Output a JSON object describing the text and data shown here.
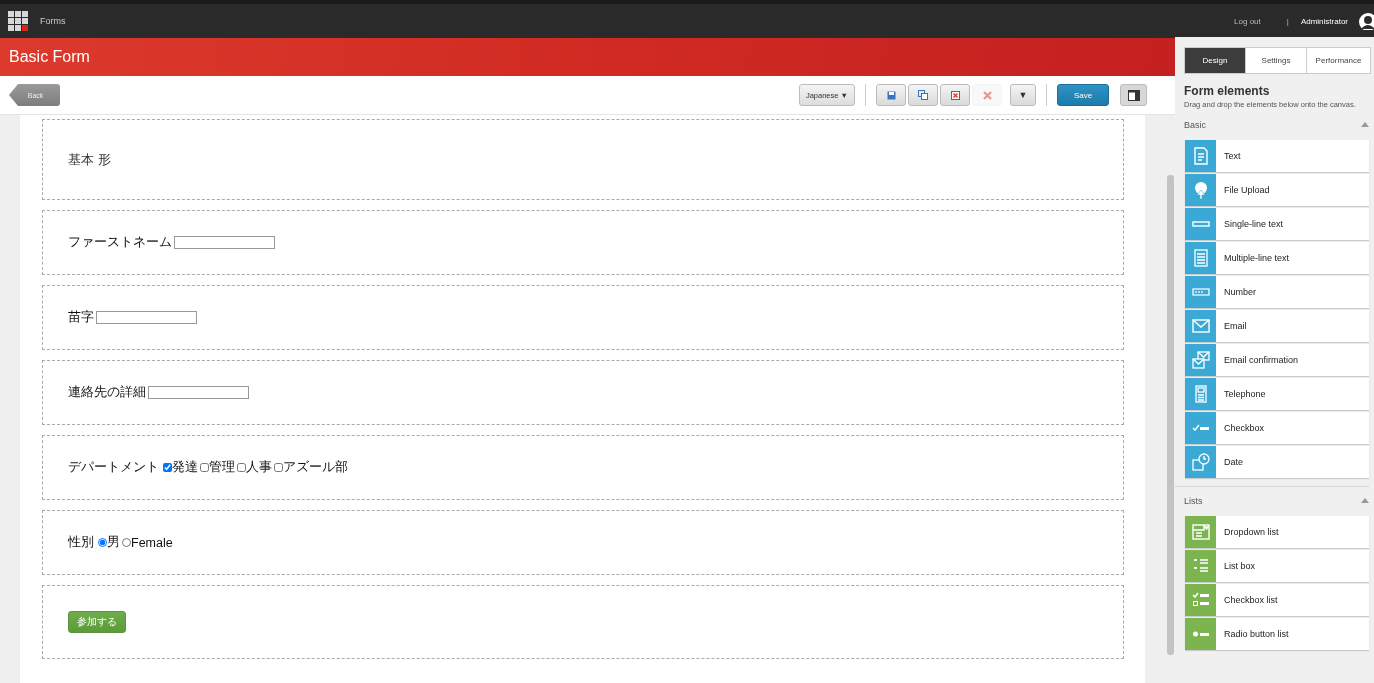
{
  "topbar": {
    "app": "Forms",
    "logout": "Log out",
    "separator": "|",
    "user": "Administrator"
  },
  "header": {
    "title": "Basic Form"
  },
  "toolbar": {
    "back": "Back",
    "language": "Japanese",
    "language_caret": "▼",
    "icon_buttons": [
      {
        "kind": "save",
        "disabled": false
      },
      {
        "kind": "save-as",
        "disabled": false
      },
      {
        "kind": "delete",
        "disabled": false
      },
      {
        "kind": "remove",
        "disabled": true
      }
    ],
    "more_caret": "▼",
    "save": "Save"
  },
  "form": [
    {
      "kind": "heading",
      "text": "基本 形"
    },
    {
      "kind": "text-field",
      "label": "ファーストネーム"
    },
    {
      "kind": "text-field",
      "label": "苗字"
    },
    {
      "kind": "text-field",
      "label": "連絡先の詳細"
    },
    {
      "kind": "checkbox-group",
      "label": "デパートメント",
      "options": [
        {
          "label": "発達",
          "checked": true
        },
        {
          "label": "管理",
          "checked": false
        },
        {
          "label": "人事",
          "checked": false
        },
        {
          "label": "アズール部",
          "checked": false
        }
      ]
    },
    {
      "kind": "radio-group",
      "label": "性別",
      "options": [
        {
          "label": "男",
          "selected": true
        },
        {
          "label": "Female",
          "selected": false
        }
      ]
    },
    {
      "kind": "button",
      "text": "参加する"
    }
  ],
  "panel": {
    "tabs": [
      {
        "label": "Design",
        "selected": true
      },
      {
        "label": "Settings",
        "selected": false
      },
      {
        "label": "Performance",
        "selected": false
      }
    ],
    "title": "Form elements",
    "description": "Drag and drop the elements below onto the canvas.",
    "groups": [
      {
        "title": "Basic",
        "expanded": true,
        "color": "#3aa9d6",
        "items": [
          {
            "label": "Text",
            "kind": "text"
          },
          {
            "label": "File Upload",
            "kind": "upload"
          },
          {
            "label": "Single-line text",
            "kind": "single-line"
          },
          {
            "label": "Multiple-line text",
            "kind": "multi-line"
          },
          {
            "label": "Number",
            "kind": "number"
          },
          {
            "label": "Email",
            "kind": "email"
          },
          {
            "label": "Email confirmation",
            "kind": "email-confirm"
          },
          {
            "label": "Telephone",
            "kind": "phone"
          },
          {
            "label": "Checkbox",
            "kind": "checkbox"
          },
          {
            "label": "Date",
            "kind": "date"
          }
        ]
      },
      {
        "title": "Lists",
        "expanded": true,
        "color": "#7cb550",
        "items": [
          {
            "label": "Dropdown list",
            "kind": "dropdown"
          },
          {
            "label": "List box",
            "kind": "listbox"
          },
          {
            "label": "Checkbox list",
            "kind": "checkbox-list"
          },
          {
            "label": "Radio button list",
            "kind": "radio-list"
          }
        ]
      }
    ]
  }
}
